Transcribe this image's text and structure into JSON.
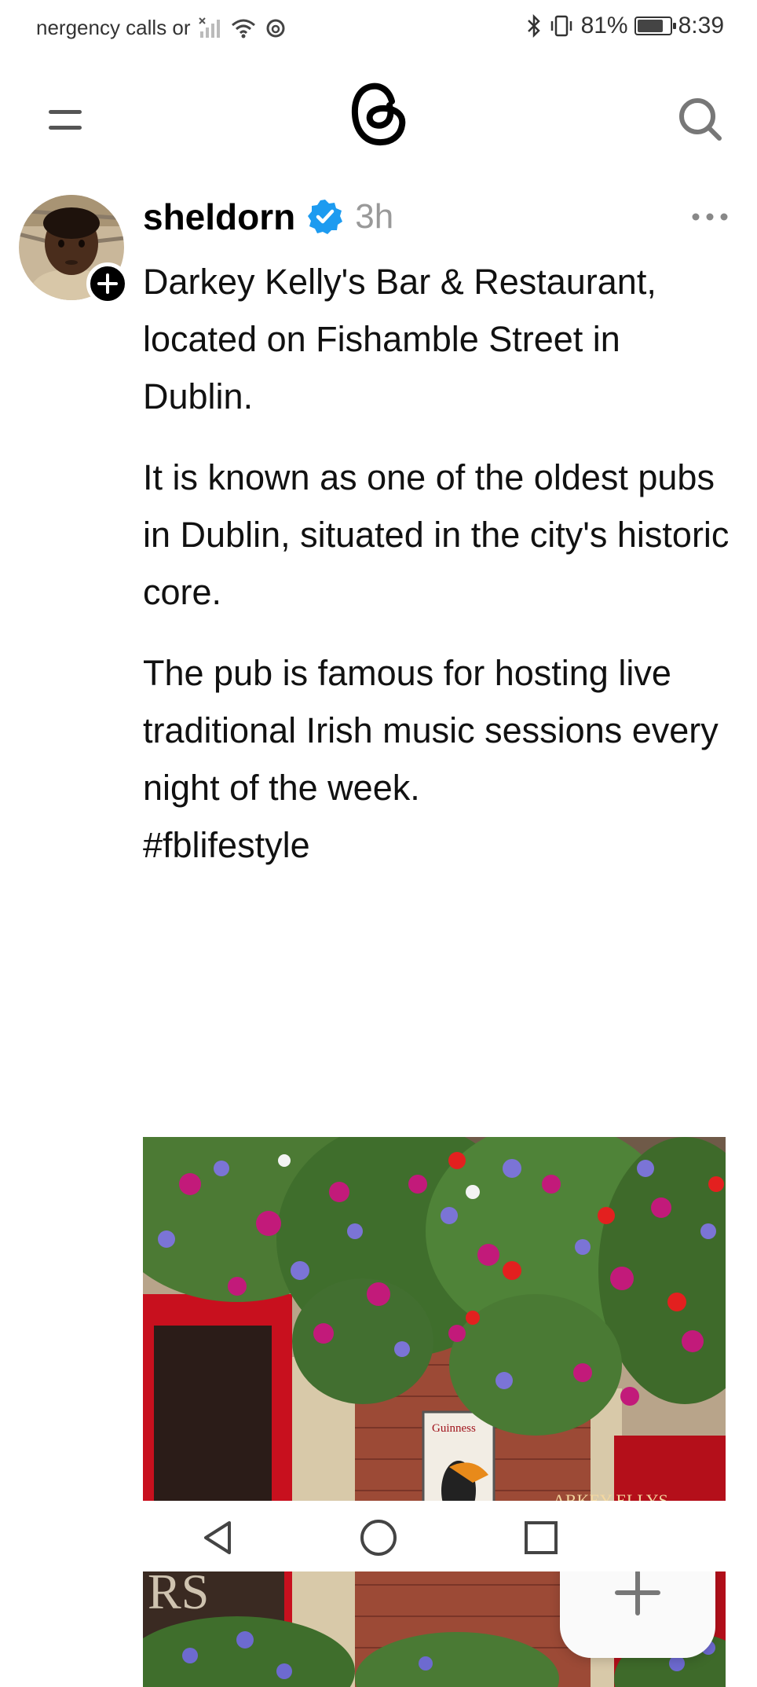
{
  "status_bar": {
    "carrier_text": "nergency calls or",
    "battery_percent": "81%",
    "battery_level": 0.81,
    "time": "8:39",
    "icons": [
      "signal-icon",
      "wifi-icon",
      "threads-status-icon",
      "bluetooth-icon",
      "vibrate-icon",
      "battery-icon"
    ]
  },
  "header": {
    "icons": [
      "menu-icon",
      "threads-logo-icon",
      "search-icon"
    ]
  },
  "post": {
    "username": "sheldorn",
    "verified": true,
    "timestamp": "3h",
    "paragraphs": [
      "Darkey Kelly's Bar & Restaurant, located on Fishamble Street in Dublin.",
      "It is known as one of the oldest pubs in Dublin, situated in the city's historic core.",
      "The pub is famous for hosting live traditional Irish music sessions every night of the week."
    ],
    "hashtag": "#fblifestyle",
    "image_sign_text": "Guinness",
    "image_sign_text_2": "ARKEY ELLYS"
  },
  "colors": {
    "verified_blue": "#1d9bf0",
    "text": "#111111",
    "muted": "#999999",
    "pub_red": "#c8101e"
  },
  "nav": {
    "icons": [
      "back-icon",
      "home-icon",
      "recents-icon"
    ]
  }
}
